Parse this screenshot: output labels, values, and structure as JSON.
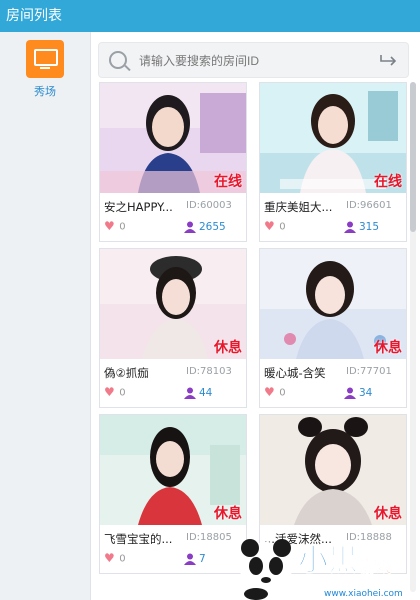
{
  "window": {
    "title": "房间列表"
  },
  "sidebar": {
    "items": [
      {
        "label": "秀场",
        "icon": "monitor-icon"
      }
    ]
  },
  "search": {
    "placeholder": "请输入要搜索的房间ID"
  },
  "rooms": [
    {
      "name": "安之HAPPY...",
      "id": "ID:60003",
      "status": "在线",
      "likes": "0",
      "viewers": "2655"
    },
    {
      "name": "重庆美姐大...",
      "id": "ID:96601",
      "status": "在线",
      "likes": "0",
      "viewers": "315"
    },
    {
      "name": "偽②抓痂",
      "id": "ID:78103",
      "status": "休息",
      "likes": "0",
      "viewers": "44"
    },
    {
      "name": "暖心城-含笑",
      "id": "ID:77701",
      "status": "休息",
      "likes": "0",
      "viewers": "34"
    },
    {
      "name": "飞雪宝宝的...",
      "id": "ID:18805",
      "status": "休息",
      "likes": "0",
      "viewers": "7"
    },
    {
      "name": "...活爱沫然...",
      "id": "ID:18888",
      "status": "休息",
      "likes": "",
      "viewers": ""
    }
  ],
  "watermark": {
    "text": "小黑游戏",
    "url": "www.xiaohei.com"
  },
  "colors": {
    "titlebar": "#32a8d8",
    "accent": "#ff8a1e",
    "status": "#e8172c",
    "viewers": "#2c8bd0"
  }
}
